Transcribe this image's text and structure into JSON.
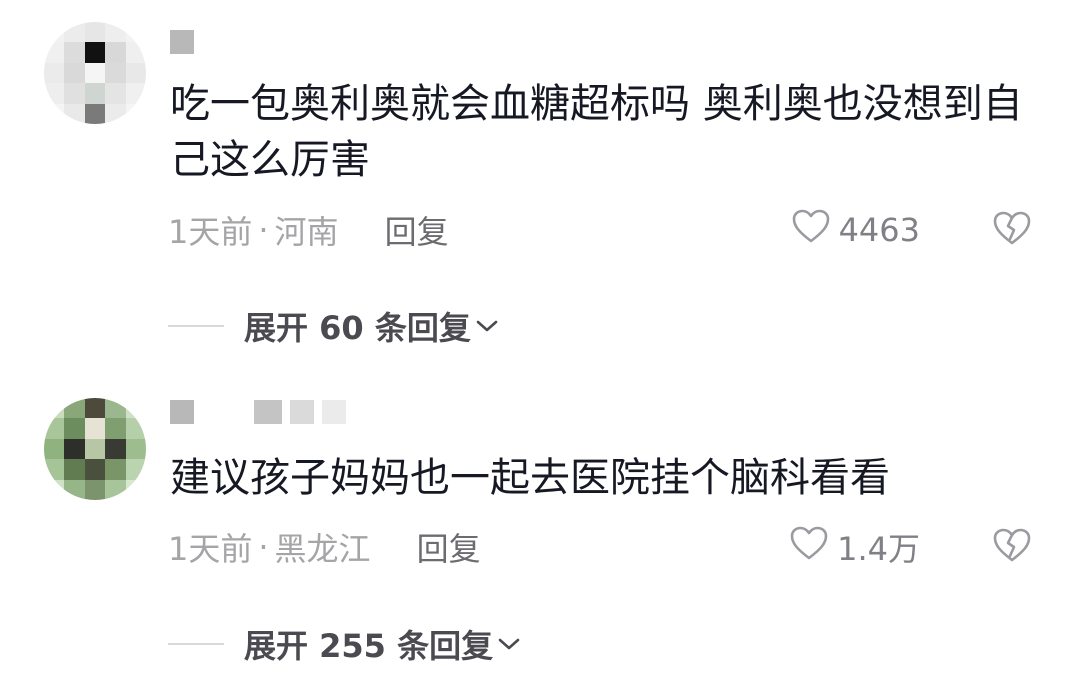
{
  "comments": [
    {
      "text": "吃一包奥利奥就会血糖超标吗 奥利奥也没想到自己这么厉害",
      "time": "1天前",
      "separator": "·",
      "location": "河南",
      "reply_label": "回复",
      "likes": "4463",
      "expand_label": "展开 60 条回复"
    },
    {
      "text": "建议孩子妈妈也一起去医院挂个脑科看看",
      "time": "1天前",
      "separator": "·",
      "location": "黑龙江",
      "reply_label": "回复",
      "likes": "1.4万",
      "expand_label": "展开 255 条回复"
    }
  ],
  "icons": {
    "like": "heart-outline-icon",
    "dislike": "broken-heart-icon",
    "expand": "chevron-down-icon"
  },
  "colors": {
    "text": "#161823",
    "meta": "#a5a5a8",
    "reply": "#6b6b70",
    "expand": "#4a4a50"
  }
}
